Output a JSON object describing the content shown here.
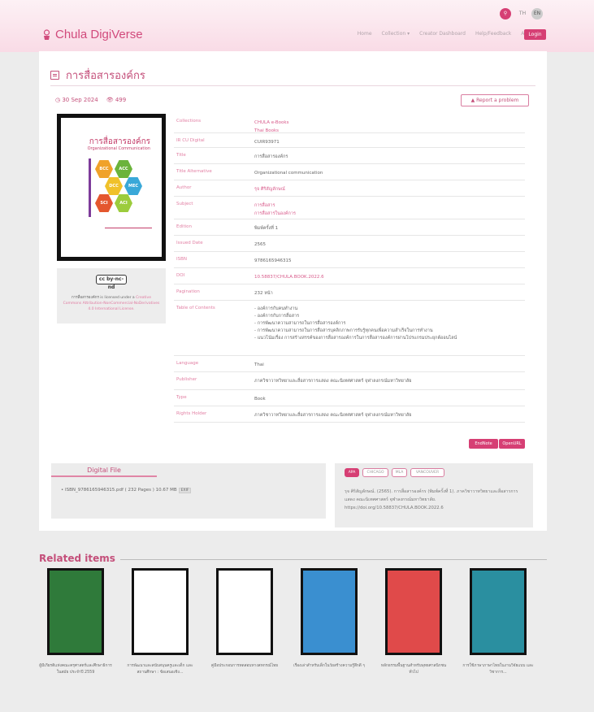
{
  "header": {
    "logo": "Chula DigiVerse",
    "lang_th": "TH",
    "lang_en": "EN",
    "nav": [
      "Home",
      "Collection ▾",
      "Creator Dashboard",
      "Help/Feedback",
      "About"
    ],
    "login": "Login"
  },
  "record": {
    "title": "การสื่อสารองค์กร",
    "date": "30 Sep 2024",
    "views": "499",
    "report": "Report a problem"
  },
  "cover": {
    "title": "การสื่อสารองค์กร",
    "subtitle": "Organizational Communication",
    "hexes": [
      "BCC",
      "ACC",
      "DCC",
      "MEC",
      "SCI",
      "ACI"
    ],
    "colors": {
      "accent": "#d63f74",
      "brand": "#c44f7a"
    }
  },
  "license": {
    "badge": "cc by-nc-nd",
    "text_prefix": "การสื่อสารองค์กร is licensed under a",
    "text_link": "Creative Commons Attribution-NonCommercial-NoDerivatives 4.0 International License."
  },
  "meta_rows": [
    {
      "k": "Collections",
      "v": "CHULA e-Books\nThai Books",
      "pink": true
    },
    {
      "k": "IR CU Digital",
      "v": "CUIR93971"
    },
    {
      "k": "Title",
      "v": "การสื่อสารองค์กร"
    },
    {
      "k": "Title Alternative",
      "v": "Organizational communication"
    },
    {
      "k": "Author",
      "v": "รุจ ศิริสัญลักษณ์",
      "pink": true
    },
    {
      "k": "Subject",
      "v": "การสื่อสาร\nการสื่อสารในองค์การ",
      "pink": true
    },
    {
      "k": "Edition",
      "v": "พิมพ์ครั้งที่ 1"
    },
    {
      "k": "Issued Date",
      "v": "2565"
    },
    {
      "k": "ISBN",
      "v": "9786165946315"
    },
    {
      "k": "DOI",
      "v": "10.58837/CHULA.BOOK.2022.6",
      "pink": true
    },
    {
      "k": "Pagination",
      "v": "232 หน้า"
    },
    {
      "k": "Table of Contents",
      "v": "- องค์การกับคนทำงาน\n- องค์การกับการสื่อสาร\n- การพัฒนาความสามารถในการสื่อสารองค์การ\n- การพัฒนาความสามารถในการสื่อสารบุคลิกภาพการรับรู้ทุกคนเพื่อความสำเร็จในการทำงาน\n- แนวโน้มเรื่อง การสร้างสรรค์ของการสื่อสารองค์การในการสื่อสารองค์การผ่านโปรแกรมประยุกต์ออนไลน์"
    },
    {
      "k": "Language",
      "v": "Thai"
    },
    {
      "k": "Publisher",
      "v": "ภาควิชาวาทวิทยาและสื่อสารการแสดง คณะนิเทศศาสตร์ จุฬาลงกรณ์มหาวิทยาลัย"
    },
    {
      "k": "Type",
      "v": "Book"
    },
    {
      "k": "Rights Holder",
      "v": "ภาควิชาวาทวิทยาและสื่อสารการแสดง คณะนิเทศศาสตร์ จุฬาลงกรณ์มหาวิทยาลัย"
    }
  ],
  "export": {
    "endnote": "EndNote",
    "openurl": "OpenURL"
  },
  "digital_file": {
    "title": "Digital File",
    "file": "ISBN_9786165946315.pdf ( 232 Pages ) 10.67 MB",
    "exif": "EXIF"
  },
  "citation": {
    "tabs": [
      "APA",
      "CHICAGO",
      "MLA",
      "VANCOUVER"
    ],
    "text": "รุจ ศิริสัญลักษณ์. (2565). การสื่อสารองค์กร (พิมพ์ครั้งที่ 1). ภาควิชาวาทวิทยาและสื่อสารการแสดง คณะนิเทศศาสตร์ จุฬาลงกรณ์มหาวิทยาลัย. https://doi.org/10.58837/CHULA.BOOK.2022.6"
  },
  "related": {
    "title": "Related items",
    "items": [
      {
        "caption": "ผู้มีเกียรติแห่งคณะครุศาสตร์และศึกษาธิการในสมัย ประจำปี 2559"
      },
      {
        "caption": "การพัฒนาและสนับสนุนครูและเด็ก และสถานศึกษา : ข้อเสนอเชิง..."
      },
      {
        "caption": "คู่มือประกอบการทดสอบทางสหกรณ์ไทย"
      },
      {
        "caption": "เรื่องเล่าสำหรับเด็กในวัยสร้างความรู้สึกดี ๆ"
      },
      {
        "caption": "หลักธรรมพื้นฐานสำหรับพุทธศาสนิกชนทั่วไป"
      },
      {
        "caption": "การใช้ภาษาภาษาไทยในงานวิจัยแบบ และวิชาการ..."
      }
    ]
  }
}
